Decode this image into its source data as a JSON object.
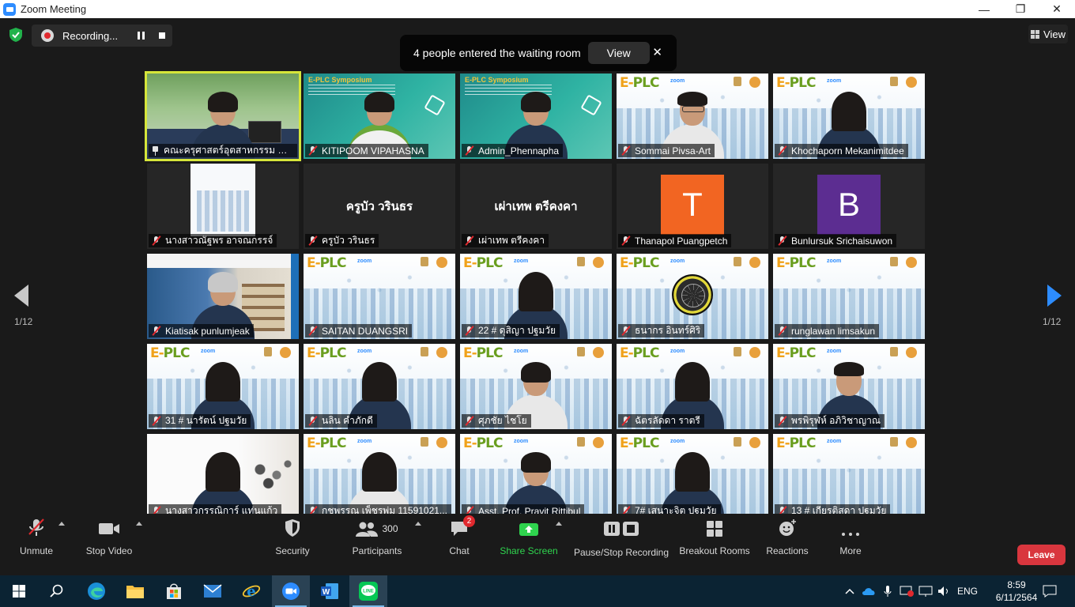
{
  "window": {
    "title": "Zoom Meeting",
    "minimize": "—",
    "maximize": "❐",
    "close": "✕"
  },
  "recording": {
    "label": "Recording..."
  },
  "banner": {
    "text": "4 people entered the waiting room",
    "view_label": "View",
    "close": "✕"
  },
  "view_button": {
    "label": "View"
  },
  "pager": {
    "left": "1/12",
    "right": "1/12"
  },
  "participants": [
    {
      "name": "คณะครุศาสตร์อุตสาหกรรม มทร...",
      "bg": "nature",
      "person": "dark",
      "pinned": true,
      "active": true
    },
    {
      "name": "KITIPOOM VIPAHASNA",
      "bg": "teal",
      "header": "E-PLC Symposium",
      "person": "green"
    },
    {
      "name": "Admin_Phennapha",
      "bg": "teal",
      "header": "E-PLC Symposium",
      "person": "dark glasses"
    },
    {
      "name": "Sommai Pivsa-Art",
      "bg": "city",
      "person": "white glasses lt"
    },
    {
      "name": "Khochaporn Mekanimitdee",
      "bg": "city",
      "person": "dark glasses long"
    },
    {
      "name": "นางสาวณัฐพร อาจณกรรจ์",
      "bg": "doc"
    },
    {
      "name": "ครูบัว วรินธร",
      "bg": "dark",
      "center": "ครูบัว วรินธร"
    },
    {
      "name": "เผ่าเทพ ตรีคงคา",
      "bg": "dark",
      "center": "เผ่าเทพ ตรีคงคา"
    },
    {
      "name": "Thanapol Puangpetch",
      "bg": "dark",
      "letter": "T",
      "letter_color": "#f26522"
    },
    {
      "name": "Bunlursuk Srichaisuwon",
      "bg": "dark",
      "letter": "B",
      "letter_color": "#5c2d91"
    },
    {
      "name": "Kiatisak punlumjeak",
      "bg": "web",
      "person": "gray glasses dark"
    },
    {
      "name": "SAITAN DUANGSRI",
      "bg": "city"
    },
    {
      "name": "22 # ดุสิญา ปฐมวัย",
      "bg": "city",
      "person": "dark long"
    },
    {
      "name": "ธนากร อินทร์ศิริ",
      "bg": "city",
      "orb": true
    },
    {
      "name": "runglawan limsakun",
      "bg": "city"
    },
    {
      "name": "31 # นารัตน์ ปฐมวัย",
      "bg": "city",
      "person": "dark glasses long"
    },
    {
      "name": "นลิน คำภักดี",
      "bg": "city",
      "person": "dark long"
    },
    {
      "name": "ศุภชัย ไชโย",
      "bg": "city",
      "person": "white"
    },
    {
      "name": "ฉัตรลัดดา ราตรี",
      "bg": "city",
      "person": "dark long"
    },
    {
      "name": "พรพิรุฬห์ อภิวิชาญาณ",
      "bg": "city",
      "person": "dark lt"
    },
    {
      "name": "นางสาวกรรณิการ์ แท่นแก้ว",
      "bg": "paint",
      "person": "dark glasses long"
    },
    {
      "name": "กชพรรณ เพ็ชรพุ่ม 11591021...",
      "bg": "city",
      "person": "white long"
    },
    {
      "name": "Asst. Prof. Pravit Rittibul",
      "bg": "city",
      "person": "dark"
    },
    {
      "name": "7# เสนาะจิต ปฐมวัย",
      "bg": "city",
      "person": "dark long"
    },
    {
      "name": "13 # เกียรติสุดา ปฐมวัย",
      "bg": "city"
    }
  ],
  "toolbar": {
    "unmute": "Unmute",
    "stop_video": "Stop Video",
    "security": "Security",
    "participants": "Participants",
    "participants_count": "300",
    "chat": "Chat",
    "chat_badge": "2",
    "share_screen": "Share Screen",
    "pause_stop_recording": "Pause/Stop Recording",
    "breakout_rooms": "Breakout Rooms",
    "reactions": "Reactions",
    "more": "More",
    "leave": "Leave"
  },
  "taskbar": {
    "apps": [
      "start-icon",
      "search-icon",
      "edge-icon",
      "file-explorer-icon",
      "store-icon",
      "mail-icon",
      "internet-explorer-icon",
      "zoom-icon",
      "word-icon",
      "line-icon"
    ],
    "language": "ENG",
    "time": "8:59",
    "date": "6/11/2564"
  },
  "colors": {
    "share_green": "#2fd44e",
    "leave_red": "#d9363e",
    "active_border": "#d6e63a",
    "mic_red": "#e0292e",
    "taskbar": "#0b2333"
  }
}
